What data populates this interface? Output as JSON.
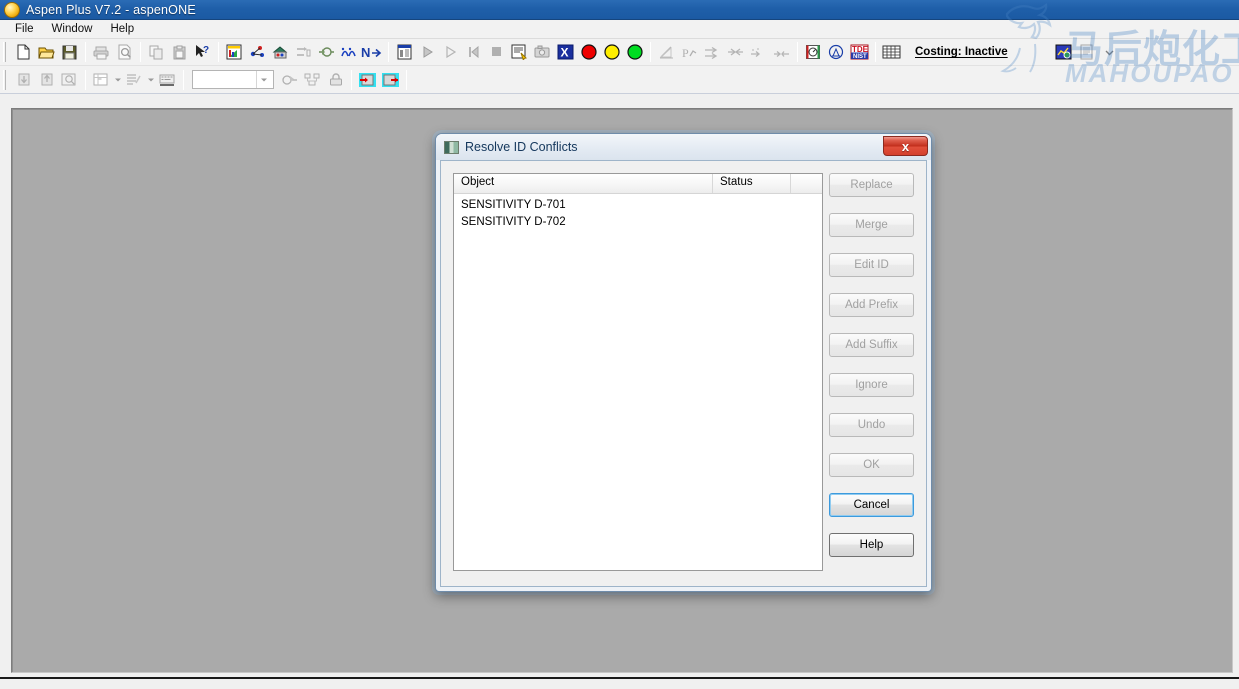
{
  "window": {
    "title": "Aspen Plus V7.2 - aspenONE",
    "icon": "aspen-orb-icon"
  },
  "menu": {
    "items": [
      {
        "label": "File",
        "name": "menu-file"
      },
      {
        "label": "Window",
        "name": "menu-window"
      },
      {
        "label": "Help",
        "name": "menu-help"
      }
    ]
  },
  "toolbar": {
    "costing_status": "Costing: Inactive",
    "combo_value": "",
    "row1": [
      {
        "name": "new-icon"
      },
      {
        "name": "open-folder-icon"
      },
      {
        "name": "save-icon"
      },
      {
        "name": "print-icon"
      },
      {
        "name": "print-preview-icon"
      },
      {
        "name": "copy-icon"
      },
      {
        "name": "paste-icon"
      },
      {
        "name": "help-pointer-icon"
      },
      {
        "name": "data-browser-icon"
      },
      {
        "name": "property-sets-icon"
      },
      {
        "name": "model-library-icon"
      },
      {
        "name": "stream-summary-icon"
      },
      {
        "name": "reconcile-streams-icon"
      },
      {
        "name": "binary-analysis-icon"
      },
      {
        "name": "next-step-icon"
      },
      {
        "name": "input-summary-icon"
      },
      {
        "name": "run-icon"
      },
      {
        "name": "step-icon"
      },
      {
        "name": "reinitialize-icon"
      },
      {
        "name": "stop-icon"
      },
      {
        "name": "results-icon"
      },
      {
        "name": "camera-icon"
      },
      {
        "name": "excel-export-icon"
      },
      {
        "name": "status-red-icon"
      },
      {
        "name": "status-yellow-icon"
      },
      {
        "name": "status-green-icon"
      },
      {
        "name": "plot-wizard-icon"
      },
      {
        "name": "pressure-curve-icon"
      },
      {
        "name": "stream-table-icon"
      },
      {
        "name": "heat-curve-icon"
      },
      {
        "name": "residue-curve-icon"
      },
      {
        "name": "sensitivity-plot-icon"
      },
      {
        "name": "analysis-icon"
      },
      {
        "name": "tde-nist-icon"
      },
      {
        "name": "grid-icon"
      },
      {
        "name": "costing-icon"
      },
      {
        "name": "report-icon"
      }
    ],
    "row2": [
      {
        "name": "import-icon"
      },
      {
        "name": "export-icon"
      },
      {
        "name": "view-data-icon"
      },
      {
        "name": "table-format-icon"
      },
      {
        "name": "list-format-icon"
      },
      {
        "name": "keyboard-icon"
      },
      {
        "name": "flowsheet-scope-icon"
      },
      {
        "name": "hierarchy-icon"
      },
      {
        "name": "lock-icon"
      },
      {
        "name": "stream-left-icon"
      },
      {
        "name": "stream-right-icon"
      }
    ]
  },
  "dialog": {
    "title": "Resolve ID Conflicts",
    "icon": "resolve-conflicts-icon",
    "close_label": "x",
    "list": {
      "columns": [
        "Object",
        "Status",
        ""
      ],
      "rows": [
        {
          "object": "SENSITIVITY D-701",
          "status": ""
        },
        {
          "object": "SENSITIVITY D-702",
          "status": ""
        }
      ]
    },
    "buttons": [
      {
        "label": "Replace",
        "name": "replace-button",
        "enabled": false,
        "focused": false
      },
      {
        "label": "Merge",
        "name": "merge-button",
        "enabled": false,
        "focused": false
      },
      {
        "label": "Edit ID",
        "name": "edit-id-button",
        "enabled": false,
        "focused": false
      },
      {
        "label": "Add Prefix",
        "name": "add-prefix-button",
        "enabled": false,
        "focused": false
      },
      {
        "label": "Add Suffix",
        "name": "add-suffix-button",
        "enabled": false,
        "focused": false
      },
      {
        "label": "Ignore",
        "name": "ignore-button",
        "enabled": false,
        "focused": false
      },
      {
        "label": "Undo",
        "name": "undo-button",
        "enabled": false,
        "focused": false
      },
      {
        "label": "OK",
        "name": "ok-button",
        "enabled": false,
        "focused": false
      },
      {
        "label": "Cancel",
        "name": "cancel-button",
        "enabled": true,
        "focused": true
      },
      {
        "label": "Help",
        "name": "help-button",
        "enabled": true,
        "focused": false
      }
    ]
  },
  "watermark": {
    "chinese": "马后炮化工",
    "english": "MAHOUPAO"
  },
  "colors": {
    "titlebar": "#1f5fa9",
    "mdi_background": "#aaaaaa",
    "accent_focus": "#3c9add",
    "status_red": "#ee0000",
    "status_yellow": "#ffee00",
    "status_green": "#00dd22"
  }
}
